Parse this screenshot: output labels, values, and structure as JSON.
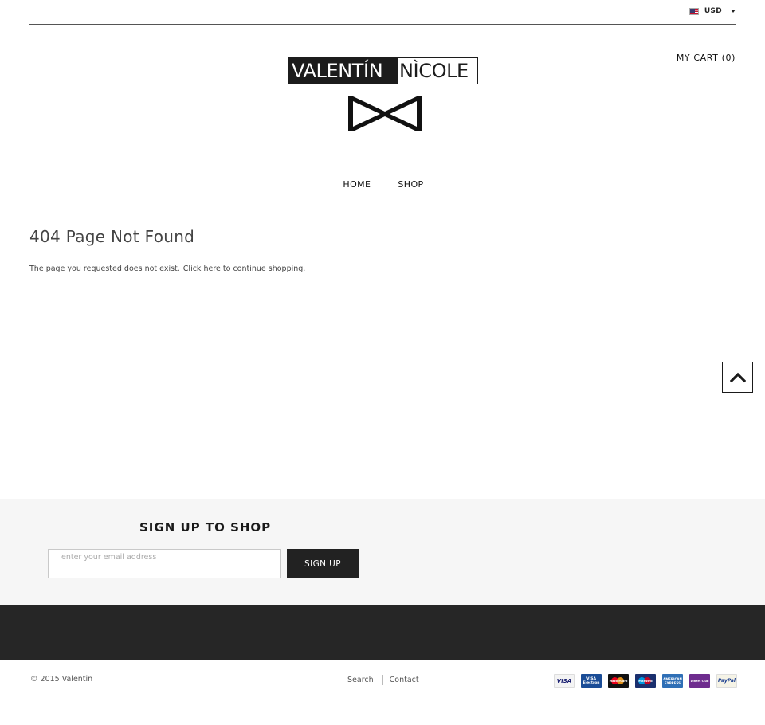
{
  "header": {
    "currency": "USD",
    "cart_label": "MY CART",
    "cart_count": "(0)",
    "logo_left": "VALENTÍN",
    "logo_right": "NÌCOLE"
  },
  "nav": {
    "items": [
      {
        "label": "HOME"
      },
      {
        "label": "SHOP"
      }
    ]
  },
  "main": {
    "title": "404 Page Not Found",
    "message_start": "The page you requested does not exist.",
    "message_link": "Click here to continue shopping."
  },
  "newsletter": {
    "title": "SIGN UP TO SHOP",
    "placeholder": "enter your email address",
    "button": "SIGN UP"
  },
  "footer": {
    "copyright": "© 2015 Valentin",
    "links": [
      {
        "label": "Search"
      },
      {
        "label": "Contact"
      }
    ],
    "payment_cards": [
      {
        "name": "visa-card-icon",
        "label": "VISA"
      },
      {
        "name": "visa-electron-card-icon",
        "label": "VISA",
        "sub": "Electron"
      },
      {
        "name": "mastercard-card-icon",
        "label": "MasterCard"
      },
      {
        "name": "maestro-card-icon",
        "label": "Maestro"
      },
      {
        "name": "american-express-card-icon",
        "label": "AMERICAN",
        "sub": "EXPRESS"
      },
      {
        "name": "diners-club-card-icon",
        "label": "Diners Club"
      },
      {
        "name": "paypal-card-icon",
        "label": "PayPal"
      }
    ]
  },
  "colors": {
    "dark": "#222222",
    "band": "#262626",
    "newsletter_bg": "#f6f6f6",
    "text": "#444444"
  }
}
